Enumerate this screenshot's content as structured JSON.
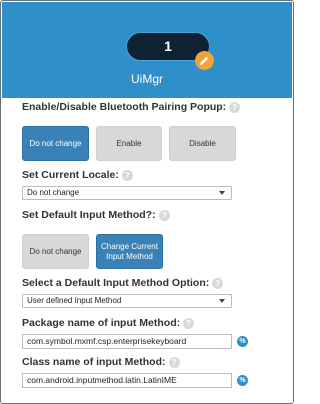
{
  "header": {
    "count": "1",
    "title": "UiMgr",
    "edit_icon": "pencil-icon",
    "accent": "#2f8fc9"
  },
  "bluetooth": {
    "label": "Enable/Disable Bluetooth Pairing Popup:",
    "buttons": [
      "Do not change",
      "Enable",
      "Disable"
    ],
    "selected": "Do not change"
  },
  "locale": {
    "label": "Set Current Locale:",
    "value": "Do not change"
  },
  "default_input": {
    "label": "Set Default Input Method?:",
    "buttons": [
      "Do not change",
      "Change Current Input Method"
    ],
    "selected": "Change Current Input Method"
  },
  "input_option": {
    "label": "Select a Default Input Method Option:",
    "value": "User defined Input Method"
  },
  "package": {
    "label": "Package name of input Method:",
    "value": "com.symbol.mxmf.csp.enterprisekeyboard"
  },
  "class_name": {
    "label": "Class name of input Method:",
    "value": "com.android.inputmethod.latin.LatinIME"
  },
  "help_glyph": "?",
  "variable_glyph": "%"
}
